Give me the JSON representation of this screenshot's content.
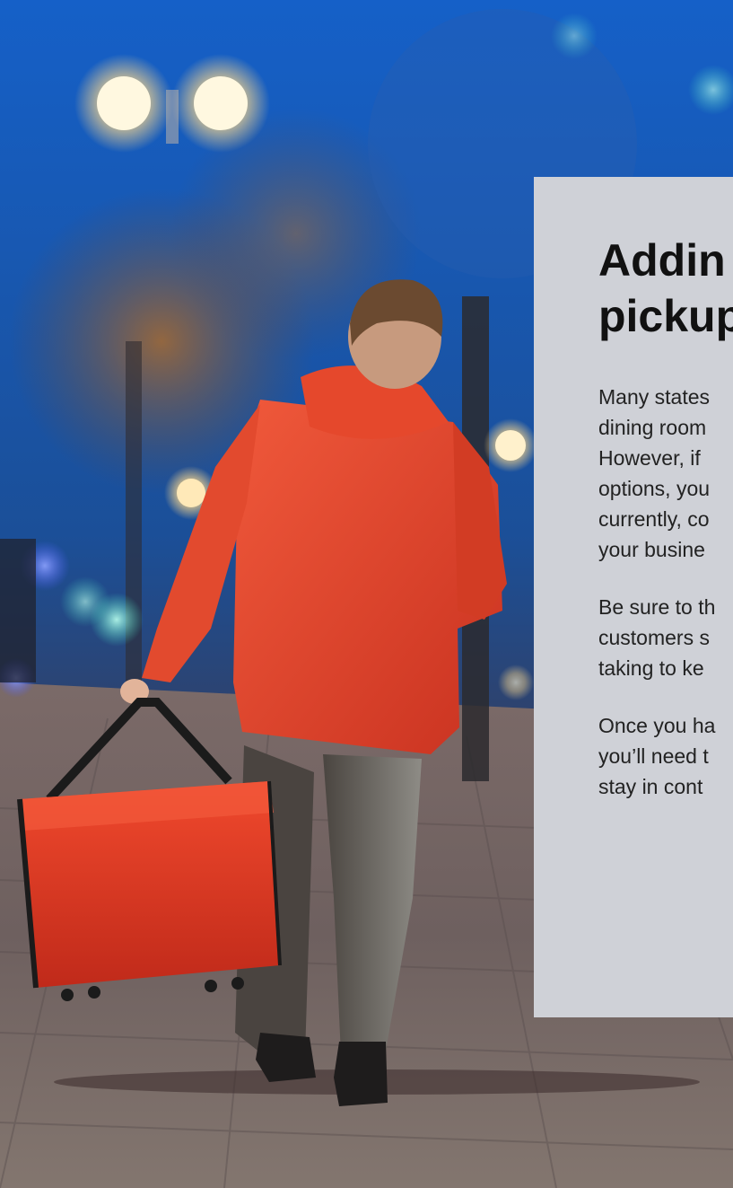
{
  "hero": {
    "image": "delivery-courier-photo",
    "colors": {
      "sky": "#1d4f9a",
      "jacket": "#e8442a",
      "bag": "#e23b24",
      "pavement": "#6e5e5e",
      "card": "#cfd1d7"
    }
  },
  "card": {
    "title": "Addin\npickup",
    "paragraphs": [
      "Many states\ndining room\nHowever, if\noptions, you\ncurrently, co\nyour busine",
      "Be sure to th\ncustomers s\ntaking to ke",
      "Once you ha\nyou’ll need t\nstay in cont"
    ]
  }
}
